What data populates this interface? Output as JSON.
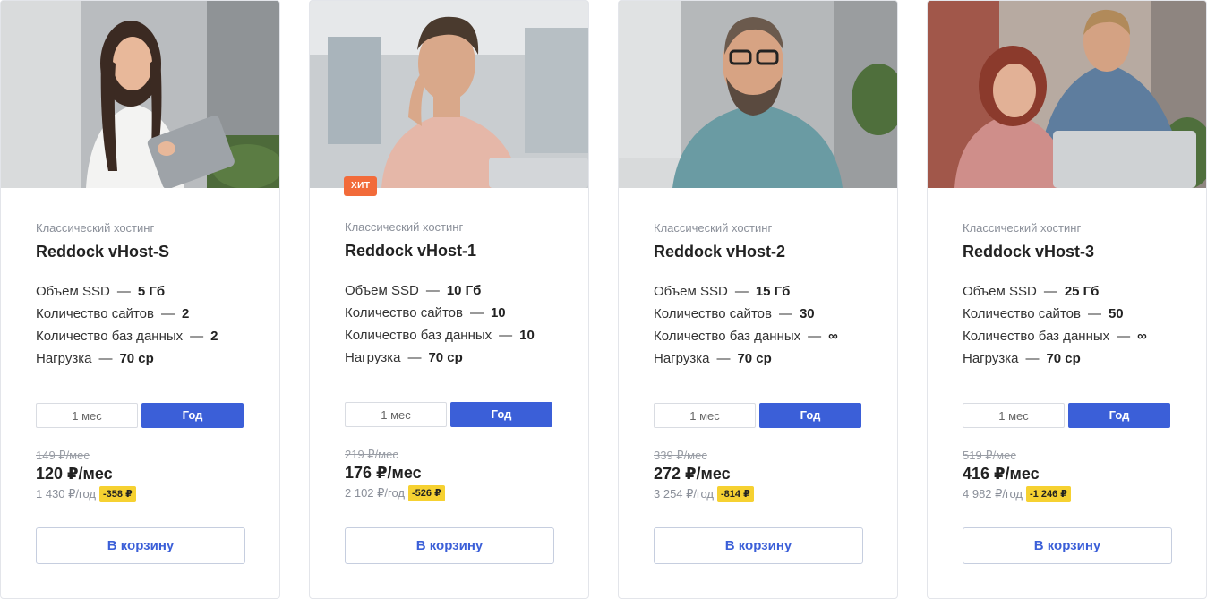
{
  "cards": [
    {
      "category": "Классический хостинг",
      "title": "Reddock vHost-S",
      "specs": [
        {
          "label": "Объем SSD",
          "value": "5 Гб"
        },
        {
          "label": "Количество сайтов",
          "value": "2"
        },
        {
          "label": "Количество баз данных",
          "value": "2"
        },
        {
          "label": "Нагрузка",
          "value": "70 ср"
        }
      ],
      "period_month": "1 мес",
      "period_year": "Год",
      "old_price": "149 ₽/мес",
      "price": "120 ₽/мес",
      "year_price": "1 430 ₽/год",
      "discount": "-358 ₽",
      "cart": "В корзину"
    },
    {
      "badge": "ХИТ",
      "category": "Классический хостинг",
      "title": "Reddock vHost-1",
      "specs": [
        {
          "label": "Объем SSD",
          "value": "10 Гб"
        },
        {
          "label": "Количество сайтов",
          "value": "10"
        },
        {
          "label": "Количество баз данных",
          "value": "10"
        },
        {
          "label": "Нагрузка",
          "value": "70 ср"
        }
      ],
      "period_month": "1 мес",
      "period_year": "Год",
      "old_price": "219 ₽/мес",
      "price": "176 ₽/мес",
      "year_price": "2 102 ₽/год",
      "discount": "-526 ₽",
      "cart": "В корзину"
    },
    {
      "category": "Классический хостинг",
      "title": "Reddock vHost-2",
      "specs": [
        {
          "label": "Объем SSD",
          "value": "15 Гб"
        },
        {
          "label": "Количество сайтов",
          "value": "30"
        },
        {
          "label": "Количество баз данных",
          "value": "∞"
        },
        {
          "label": "Нагрузка",
          "value": "70 ср"
        }
      ],
      "period_month": "1 мес",
      "period_year": "Год",
      "old_price": "339 ₽/мес",
      "price": "272 ₽/мес",
      "year_price": "3 254 ₽/год",
      "discount": "-814 ₽",
      "cart": "В корзину"
    },
    {
      "category": "Классический хостинг",
      "title": "Reddock vHost-3",
      "specs": [
        {
          "label": "Объем SSD",
          "value": "25 Гб"
        },
        {
          "label": "Количество сайтов",
          "value": "50"
        },
        {
          "label": "Количество баз данных",
          "value": "∞"
        },
        {
          "label": "Нагрузка",
          "value": "70 ср"
        }
      ],
      "period_month": "1 мес",
      "period_year": "Год",
      "old_price": "519 ₽/мес",
      "price": "416 ₽/мес",
      "year_price": "4 982 ₽/год",
      "discount": "-1 246 ₽",
      "cart": "В корзину"
    }
  ],
  "colors": {
    "accent": "#3b5fd8",
    "badge": "#f26b3a",
    "discount": "#f6d131"
  }
}
